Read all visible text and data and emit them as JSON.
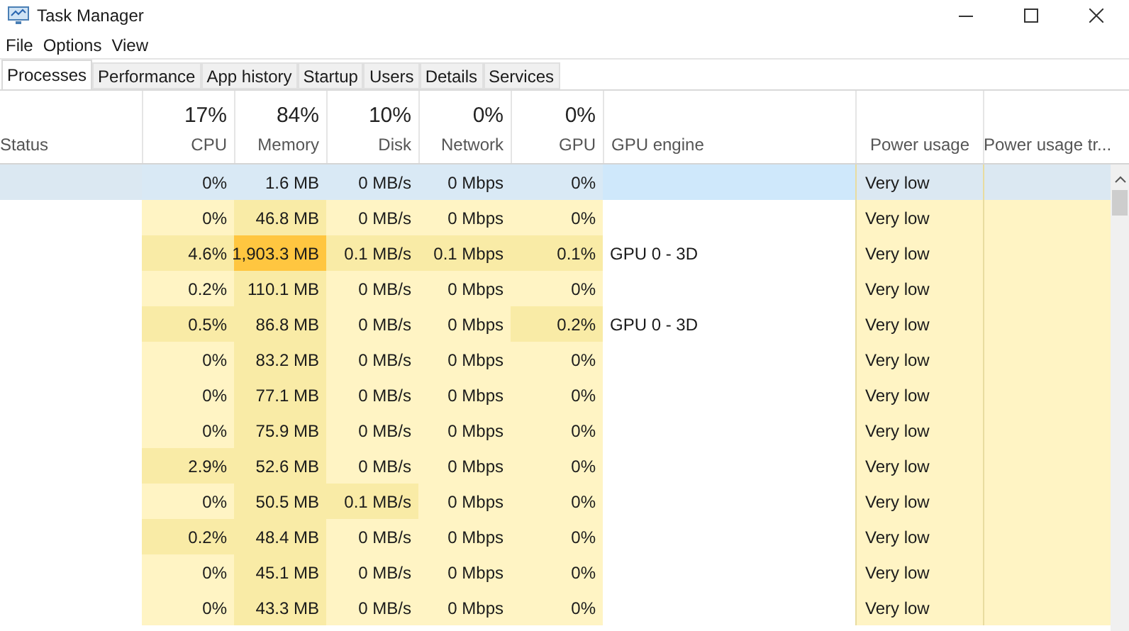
{
  "window": {
    "title": "Task Manager"
  },
  "menu": [
    "File",
    "Options",
    "View"
  ],
  "tabs": [
    {
      "label": "Processes",
      "selected": true
    },
    {
      "label": "Performance",
      "selected": false
    },
    {
      "label": "App history",
      "selected": false
    },
    {
      "label": "Startup",
      "selected": false
    },
    {
      "label": "Users",
      "selected": false
    },
    {
      "label": "Details",
      "selected": false
    },
    {
      "label": "Services",
      "selected": false
    }
  ],
  "columns": [
    {
      "label": "Status"
    },
    {
      "label": "CPU",
      "total": "17%"
    },
    {
      "label": "Memory",
      "total": "84%"
    },
    {
      "label": "Disk",
      "total": "10%"
    },
    {
      "label": "Network",
      "total": "0%"
    },
    {
      "label": "GPU",
      "total": "0%"
    },
    {
      "label": "GPU engine"
    },
    {
      "label": "Power usage"
    },
    {
      "label": "Power usage tr..."
    }
  ],
  "rows": [
    {
      "selected": true,
      "cells": [
        {
          "text": "0%"
        },
        {
          "text": "1.6 MB"
        },
        {
          "text": "0 MB/s"
        },
        {
          "text": "0 Mbps"
        },
        {
          "text": "0%"
        }
      ],
      "power_usage": "Very low"
    },
    {
      "selected": false,
      "cells": [
        {
          "text": "0%",
          "color": "#fff4c4"
        },
        {
          "text": "46.8 MB",
          "color": "#f9eba6"
        },
        {
          "text": "0 MB/s",
          "color": "#fff4c4"
        },
        {
          "text": "0 Mbps",
          "color": "#fff4c4"
        },
        {
          "text": "0%",
          "color": "#fff4c4"
        }
      ],
      "power_usage": "Very low"
    },
    {
      "selected": false,
      "cells": [
        {
          "text": "4.6%",
          "color": "#f9eba6"
        },
        {
          "text": "1,903.3 MB",
          "color": "#ffc640"
        },
        {
          "text": "0.1 MB/s",
          "color": "#f9eba6"
        },
        {
          "text": "0.1 Mbps",
          "color": "#f9eba6"
        },
        {
          "text": "0.1%",
          "color": "#f9eba6"
        }
      ],
      "gpu_engine": "GPU 0 - 3D",
      "power_usage": "Very low"
    },
    {
      "selected": false,
      "cells": [
        {
          "text": "0.2%",
          "color": "#fff4c4"
        },
        {
          "text": "110.1 MB",
          "color": "#f9eba6"
        },
        {
          "text": "0 MB/s",
          "color": "#fff4c4"
        },
        {
          "text": "0 Mbps",
          "color": "#fff4c4"
        },
        {
          "text": "0%",
          "color": "#fff4c4"
        }
      ],
      "power_usage": "Very low"
    },
    {
      "selected": false,
      "cells": [
        {
          "text": "0.5%",
          "color": "#f9eba6"
        },
        {
          "text": "86.8 MB",
          "color": "#f9eba6"
        },
        {
          "text": "0 MB/s",
          "color": "#fff4c4"
        },
        {
          "text": "0 Mbps",
          "color": "#fff4c4"
        },
        {
          "text": "0.2%",
          "color": "#f9eba6"
        }
      ],
      "gpu_engine": "GPU 0 - 3D",
      "power_usage": "Very low"
    },
    {
      "selected": false,
      "cells": [
        {
          "text": "0%",
          "color": "#fff4c4"
        },
        {
          "text": "83.2 MB",
          "color": "#f9eba6"
        },
        {
          "text": "0 MB/s",
          "color": "#fff4c4"
        },
        {
          "text": "0 Mbps",
          "color": "#fff4c4"
        },
        {
          "text": "0%",
          "color": "#fff4c4"
        }
      ],
      "power_usage": "Very low"
    },
    {
      "selected": false,
      "cells": [
        {
          "text": "0%",
          "color": "#fff4c4"
        },
        {
          "text": "77.1 MB",
          "color": "#f9eba6"
        },
        {
          "text": "0 MB/s",
          "color": "#fff4c4"
        },
        {
          "text": "0 Mbps",
          "color": "#fff4c4"
        },
        {
          "text": "0%",
          "color": "#fff4c4"
        }
      ],
      "power_usage": "Very low"
    },
    {
      "selected": false,
      "cells": [
        {
          "text": "0%",
          "color": "#fff4c4"
        },
        {
          "text": "75.9 MB",
          "color": "#f9eba6"
        },
        {
          "text": "0 MB/s",
          "color": "#fff4c4"
        },
        {
          "text": "0 Mbps",
          "color": "#fff4c4"
        },
        {
          "text": "0%",
          "color": "#fff4c4"
        }
      ],
      "power_usage": "Very low"
    },
    {
      "selected": false,
      "cells": [
        {
          "text": "2.9%",
          "color": "#f9eba6"
        },
        {
          "text": "52.6 MB",
          "color": "#f9eba6"
        },
        {
          "text": "0 MB/s",
          "color": "#fff4c4"
        },
        {
          "text": "0 Mbps",
          "color": "#fff4c4"
        },
        {
          "text": "0%",
          "color": "#fff4c4"
        }
      ],
      "power_usage": "Very low"
    },
    {
      "selected": false,
      "cells": [
        {
          "text": "0%",
          "color": "#fff4c4"
        },
        {
          "text": "50.5 MB",
          "color": "#f9eba6"
        },
        {
          "text": "0.1 MB/s",
          "color": "#f9eba6"
        },
        {
          "text": "0 Mbps",
          "color": "#fff4c4"
        },
        {
          "text": "0%",
          "color": "#fff4c4"
        }
      ],
      "power_usage": "Very low"
    },
    {
      "selected": false,
      "cells": [
        {
          "text": "0.2%",
          "color": "#f9eba6"
        },
        {
          "text": "48.4 MB",
          "color": "#f9eba6"
        },
        {
          "text": "0 MB/s",
          "color": "#fff4c4"
        },
        {
          "text": "0 Mbps",
          "color": "#fff4c4"
        },
        {
          "text": "0%",
          "color": "#fff4c4"
        }
      ],
      "power_usage": "Very low"
    },
    {
      "selected": false,
      "cells": [
        {
          "text": "0%",
          "color": "#fff4c4"
        },
        {
          "text": "45.1 MB",
          "color": "#f9eba6"
        },
        {
          "text": "0 MB/s",
          "color": "#fff4c4"
        },
        {
          "text": "0 Mbps",
          "color": "#fff4c4"
        },
        {
          "text": "0%",
          "color": "#fff4c4"
        }
      ],
      "power_usage": "Very low"
    },
    {
      "selected": false,
      "cells": [
        {
          "text": "0%",
          "color": "#fff4c4"
        },
        {
          "text": "43.3 MB",
          "color": "#f9eba6"
        },
        {
          "text": "0 MB/s",
          "color": "#fff4c4"
        },
        {
          "text": "0 Mbps",
          "color": "#fff4c4"
        },
        {
          "text": "0%",
          "color": "#fff4c4"
        }
      ],
      "power_usage": "Very low"
    }
  ]
}
